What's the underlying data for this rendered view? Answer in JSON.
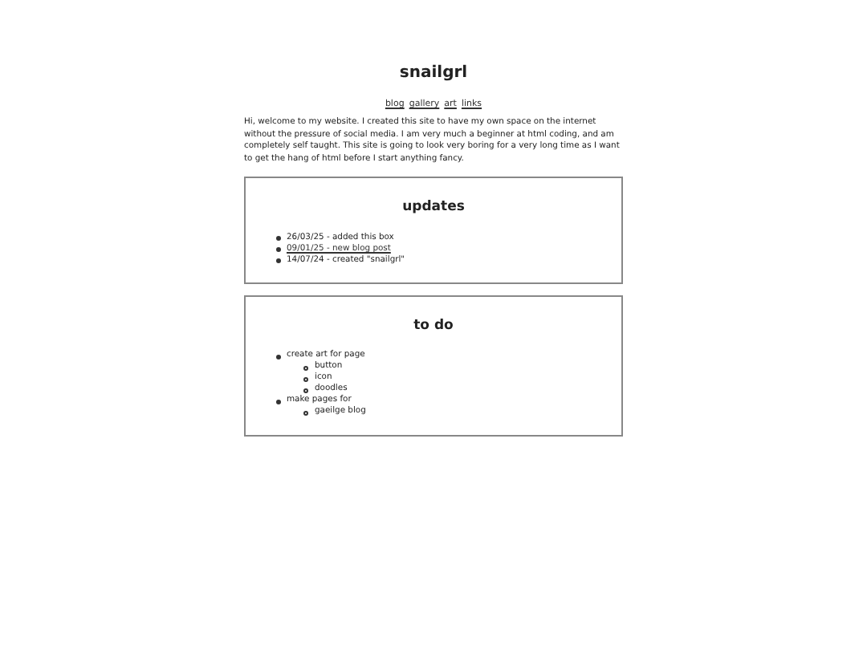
{
  "title": "snailgrl",
  "nav": [
    {
      "label": "blog"
    },
    {
      "label": "gallery"
    },
    {
      "label": "art"
    },
    {
      "label": "links"
    }
  ],
  "intro": "Hi, welcome to my website. I created this site to have my own space on the internet without the pressure of social media. I am very much a beginner at html coding, and am completely self taught. This site is going to look very boring for a very long time as I want to get the hang of html before I start anything fancy.",
  "updates": {
    "heading": "updates",
    "items": [
      {
        "kind": "text",
        "text": "26/03/25 - added this box"
      },
      {
        "kind": "link",
        "text": "09/01/25 - new blog post"
      },
      {
        "kind": "text",
        "text": "14/07/24 - created \"snailgrl\""
      }
    ]
  },
  "todo": {
    "heading": "to do",
    "items": [
      {
        "text": "create art for page",
        "children": [
          {
            "text": "button"
          },
          {
            "text": "icon"
          },
          {
            "text": "doodles"
          }
        ]
      },
      {
        "text": "make pages for",
        "children": [
          {
            "text": "gaeilge blog"
          }
        ]
      }
    ]
  }
}
